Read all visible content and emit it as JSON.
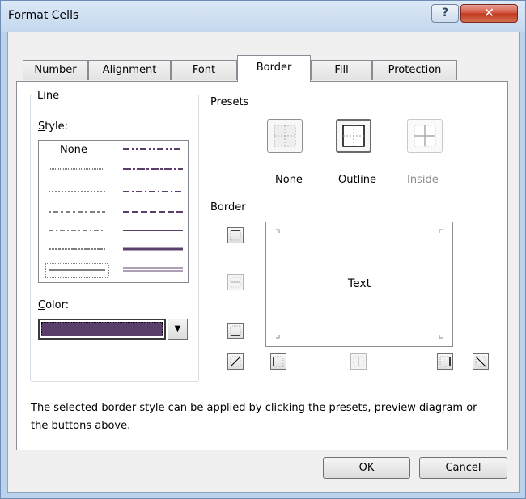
{
  "window": {
    "title": "Format Cells",
    "help_label": "?",
    "close_label": "✕"
  },
  "tabs": [
    {
      "label": "Number"
    },
    {
      "label": "Alignment"
    },
    {
      "label": "Font"
    },
    {
      "label": "Border",
      "selected": true
    },
    {
      "label": "Fill"
    },
    {
      "label": "Protection"
    }
  ],
  "line": {
    "group_label": "Line",
    "style_label_key": "S",
    "style_label_rest": "tyle:",
    "none_label": "None",
    "color_label_key": "C",
    "color_label_rest": "olor:",
    "color_value": "#5b3f6b"
  },
  "presets": {
    "group_label": "Presets",
    "items": [
      {
        "label_key": "N",
        "label_rest": "one",
        "enabled": true
      },
      {
        "label_key": "O",
        "label_rest": "utline",
        "enabled": true
      },
      {
        "label_key": "",
        "label_rest": "Inside",
        "enabled": false
      }
    ]
  },
  "border": {
    "group_label": "Border",
    "preview_text": "Text"
  },
  "description": "The selected border style can be applied by clicking the presets, preview diagram or the buttons above.",
  "buttons": {
    "ok": "OK",
    "cancel": "Cancel"
  },
  "colors": {
    "accent_line": "#5b3f6b",
    "close_red": "#c03920"
  }
}
